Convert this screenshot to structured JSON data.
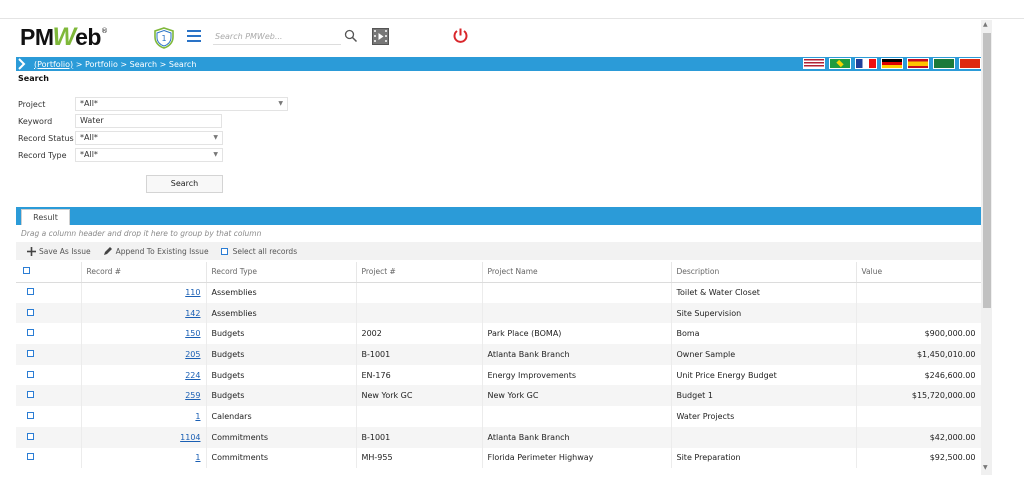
{
  "header": {
    "logo": {
      "pm": "PM",
      "w": "W",
      "eb": "eb",
      "reg": "®"
    },
    "search_placeholder": "Search PMWeb..."
  },
  "breadcrumb": {
    "link": "(Portfolio)",
    "rest": " > Portfolio > Search > Search"
  },
  "page": {
    "section_title": "Search"
  },
  "form": {
    "project_label": "Project",
    "project_value": "*All*",
    "keyword_label": "Keyword",
    "keyword_value": "Water",
    "record_status_label": "Record Status",
    "record_status_value": "*All*",
    "record_type_label": "Record Type",
    "record_type_value": "*All*",
    "search_button": "Search"
  },
  "result": {
    "tab_label": "Result",
    "group_hint": "Drag a column header and drop it here to group by that column",
    "toolbar": {
      "save_as_issue": "Save As Issue",
      "append_issue": "Append To Existing Issue",
      "select_all": "Select all records"
    },
    "columns": [
      "Record #",
      "Record Type",
      "Project #",
      "Project Name",
      "Description",
      "Value"
    ],
    "rows": [
      {
        "record": "110",
        "type": "Assemblies",
        "project_no": "",
        "project_name": "",
        "description": "Toilet & Water Closet",
        "value": ""
      },
      {
        "record": "142",
        "type": "Assemblies",
        "project_no": "",
        "project_name": "",
        "description": "Site Supervision",
        "value": ""
      },
      {
        "record": "150",
        "type": "Budgets",
        "project_no": "2002",
        "project_name": "Park Place (BOMA)",
        "description": "Boma",
        "value": "$900,000.00"
      },
      {
        "record": "205",
        "type": "Budgets",
        "project_no": "B-1001",
        "project_name": "Atlanta Bank Branch",
        "description": "Owner Sample",
        "value": "$1,450,010.00"
      },
      {
        "record": "224",
        "type": "Budgets",
        "project_no": "EN-176",
        "project_name": "Energy Improvements",
        "description": "Unit Price Energy Budget",
        "value": "$246,600.00"
      },
      {
        "record": "259",
        "type": "Budgets",
        "project_no": "New York GC",
        "project_name": "New York GC",
        "description": "Budget 1",
        "value": "$15,720,000.00"
      },
      {
        "record": "1",
        "type": "Calendars",
        "project_no": "",
        "project_name": "",
        "description": "Water Projects",
        "value": ""
      },
      {
        "record": "1104",
        "type": "Commitments",
        "project_no": "B-1001",
        "project_name": "Atlanta Bank Branch",
        "description": "",
        "value": "$42,000.00"
      },
      {
        "record": "1",
        "type": "Commitments",
        "project_no": "MH-955",
        "project_name": "Florida Perimeter Highway",
        "description": "Site Preparation",
        "value": "$92,500.00"
      }
    ]
  },
  "colors": {
    "accent_blue": "#2b9bd8",
    "logo_green": "#7fb83a",
    "power_red": "#d9262b",
    "link_blue": "#1a5fb4"
  }
}
